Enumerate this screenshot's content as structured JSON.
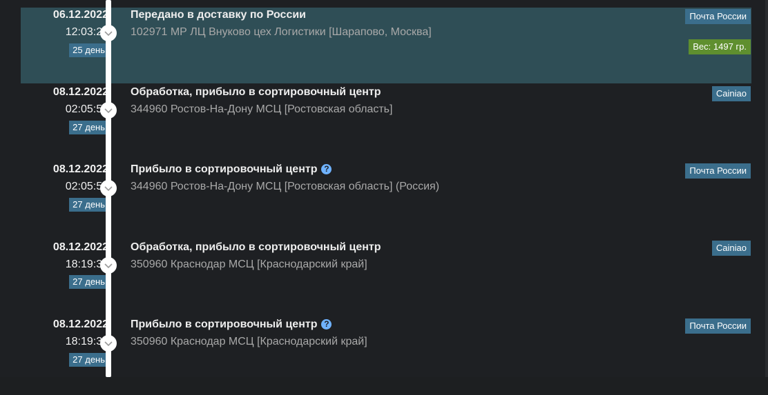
{
  "events": [
    {
      "date": "06.12.2022",
      "time": "12:03:21",
      "day": "25 день",
      "title": "Передано в доставку по России",
      "location": "102971 МР ЛЦ Внуково цех Логистики [Шарапово, Москва]",
      "carrier": "Почта России",
      "weight": "Вес: 1497 гр."
    },
    {
      "date": "08.12.2022",
      "time": "02:05:56",
      "day": "27 день",
      "title": "Обработка, прибыло в сортировочный центр",
      "location": "344960 Ростов-На-Дону МСЦ [Ростовская область]",
      "carrier": "Cainiao"
    },
    {
      "date": "08.12.2022",
      "time": "02:05:56",
      "day": "27 день",
      "title": "Прибыло в сортировочный центр",
      "location": "344960 Ростов-На-Дону МСЦ [Ростовская область] (Россия)",
      "carrier": "Почта России"
    },
    {
      "date": "08.12.2022",
      "time": "18:19:31",
      "day": "27 день",
      "title": "Обработка, прибыло в сортировочный центр",
      "location": "350960 Краснодар МСЦ [Краснодарский край]",
      "carrier": "Cainiao"
    },
    {
      "date": "08.12.2022",
      "time": "18:19:31",
      "day": "27 день",
      "title": "Прибыло в сортировочный центр",
      "location": "350960 Краснодар МСЦ [Краснодарский край]",
      "carrier": "Почта России"
    }
  ],
  "icons": {
    "help": "?",
    "node": "chevron-down-icon"
  },
  "colors": {
    "highlight": "#2f4e56",
    "badge": "#3b6e8c",
    "weight_badge": "#5f8f2f",
    "help_icon": "#6fb2ff"
  }
}
